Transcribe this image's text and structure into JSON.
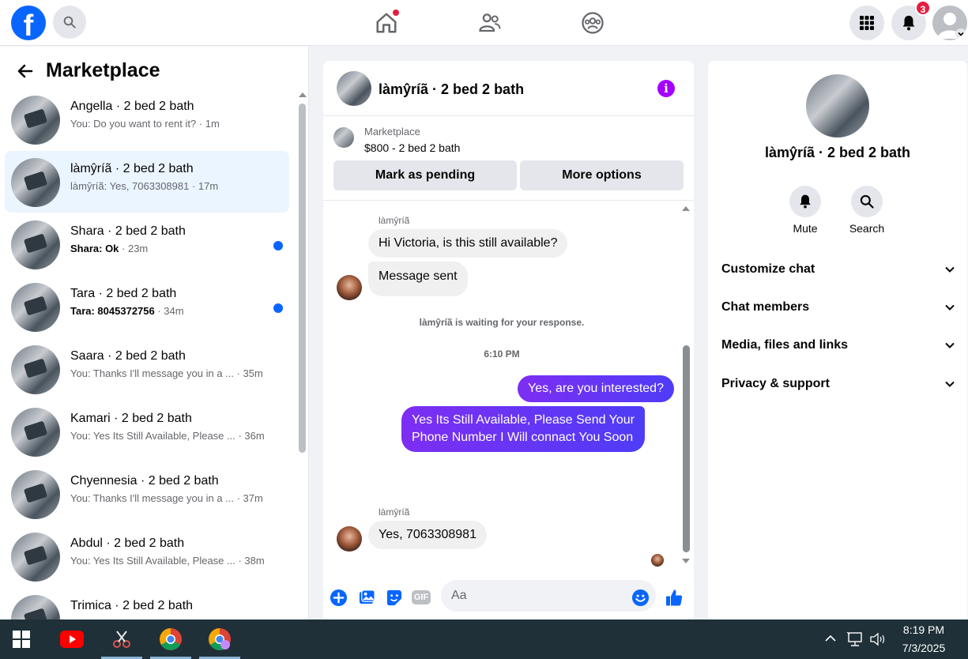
{
  "topbar": {
    "logo": "f",
    "notifications_count": "3",
    "icons": [
      "facebook-logo",
      "search-icon",
      "home-icon",
      "friends-icon",
      "groups-icon",
      "menu-grid-icon",
      "bell-icon",
      "account-icon"
    ]
  },
  "left": {
    "title": "Marketplace",
    "conversations": [
      {
        "name": "Angella · 2 bed 2 bath",
        "snippet": "You: Do you want to rent it? · 1m",
        "unread": false
      },
      {
        "name": "làmŷríã · 2 bed 2 bath",
        "snippet": "làmŷríã: Yes, 7063308981 · 17m",
        "unread": false
      },
      {
        "name": "Shara · 2 bed 2 bath",
        "snippet_sender": "Shara: Ok",
        "snippet_time": " · 23m",
        "unread": true
      },
      {
        "name": "Tara · 2 bed 2 bath",
        "snippet_sender": "Tara: 8045372756",
        "snippet_time": " · 34m",
        "unread": true
      },
      {
        "name": "Saara · 2 bed 2 bath",
        "snippet": "You: Thanks I'll message you in a ... · 35m",
        "unread": false
      },
      {
        "name": "Kamari · 2 bed 2 bath",
        "snippet": "You: Yes Its Still Available, Please ... · 36m",
        "unread": false
      },
      {
        "name": "Chyennesia · 2 bed 2 bath",
        "snippet": "You: Thanks I'll message you in a ... · 37m",
        "unread": false
      },
      {
        "name": "Abdul · 2 bed 2 bath",
        "snippet": "You: Yes Its Still Available, Please ... · 38m",
        "unread": false
      },
      {
        "name": "Trimica · 2 bed 2 bath",
        "snippet": "",
        "unread": false
      }
    ]
  },
  "chat": {
    "title": "làmŷríã · 2 bed 2 bath",
    "marketplace_label": "Marketplace",
    "listing": "$800 - 2 bed 2 bath",
    "mark_pending": "Mark as pending",
    "more_options": "More options",
    "sender_name": "làmŷríã",
    "msg1": "Hi Victoria, is this still available?",
    "msg2": "Message sent",
    "waiting": "làmŷríã is waiting for your response.",
    "time": "6:10 PM",
    "out1": "Yes, are you interested?",
    "out2_line1": "Yes Its Still Available, Please Send Your",
    "out2_line2": "Phone Number I Will connact You Soon",
    "sender_name2": "làmŷríã",
    "msg3": "Yes, 7063308981",
    "composer_placeholder": "Aa",
    "gif_label": "GIF"
  },
  "right": {
    "name": "làmŷríã · 2 bed 2 bath",
    "mute": "Mute",
    "search": "Search",
    "rows": [
      "Customize chat",
      "Chat members",
      "Media, files and links",
      "Privacy & support"
    ]
  },
  "taskbar": {
    "time": "8:19 PM",
    "date": "7/3/2025"
  },
  "colors": {
    "brand": "#0866ff",
    "outgoing_start": "#7d2ef2",
    "outgoing_end": "#4f3cf7",
    "info": "#a400ff",
    "unread_dot": "#0866ff",
    "badge": "#e41e3f"
  }
}
